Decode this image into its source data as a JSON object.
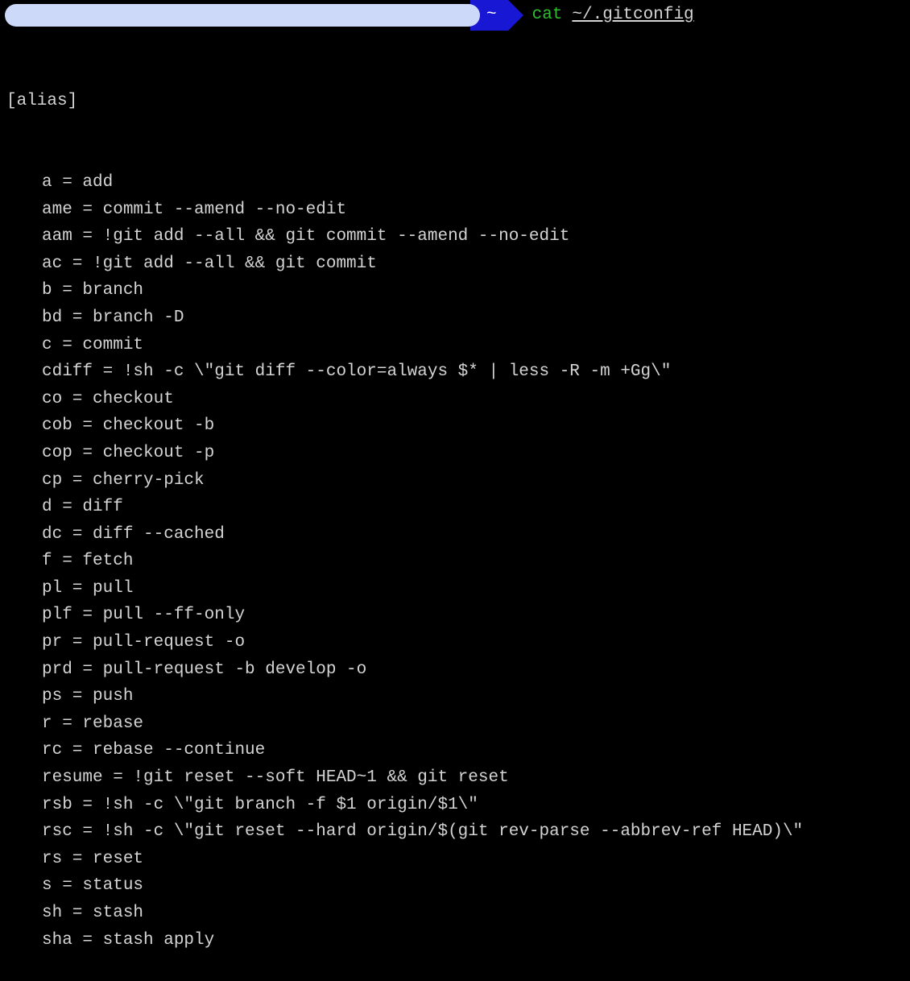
{
  "prompt": {
    "cwd_symbol": "~",
    "command": "cat",
    "argument": "~/.gitconfig"
  },
  "output": {
    "section": "[alias]",
    "lines": [
      "a = add",
      "ame = commit --amend --no-edit",
      "aam = !git add --all && git commit --amend --no-edit",
      "ac = !git add --all && git commit",
      "b = branch",
      "bd = branch -D",
      "c = commit",
      "cdiff = !sh -c \\\"git diff --color=always $* | less -R -m +Gg\\\"",
      "co = checkout",
      "cob = checkout -b",
      "cop = checkout -p",
      "cp = cherry-pick",
      "d = diff",
      "dc = diff --cached",
      "f = fetch",
      "pl = pull",
      "plf = pull --ff-only",
      "pr = pull-request -o",
      "prd = pull-request -b develop -o",
      "ps = push",
      "r = rebase",
      "rc = rebase --continue",
      "resume = !git reset --soft HEAD~1 && git reset",
      "rsb = !sh -c \\\"git branch -f $1 origin/$1\\\"",
      "rsc = !sh -c \\\"git reset --hard origin/$(git rev-parse --abbrev-ref HEAD)\\\"",
      "rs = reset",
      "s = status",
      "sh = stash",
      "sha = stash apply"
    ]
  }
}
